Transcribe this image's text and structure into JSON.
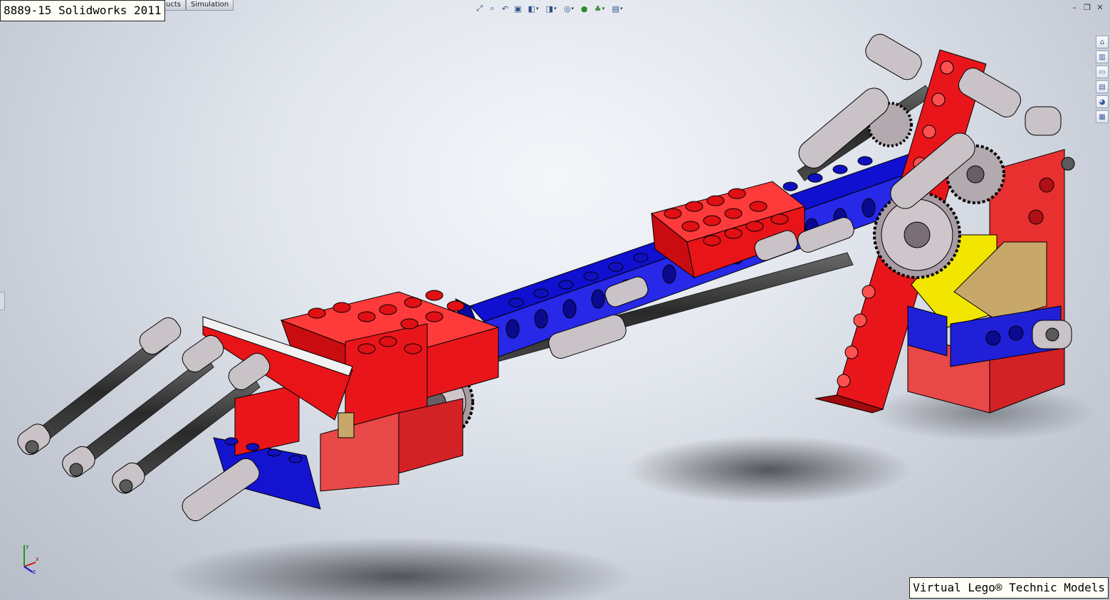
{
  "window": {
    "title": "8889-15 Solidworks 2011",
    "watermark": "Virtual Lego® Technic Models",
    "tabs": [
      "ucts",
      "Simulation"
    ]
  },
  "toolbar": {
    "icons": [
      {
        "name": "zoom-to-fit-icon",
        "glyph": "⤢"
      },
      {
        "name": "zoom-to-area-icon",
        "glyph": "⌕"
      },
      {
        "name": "previous-view-icon",
        "glyph": "↶"
      },
      {
        "name": "section-view-icon",
        "glyph": "▣"
      },
      {
        "name": "view-orientation-icon",
        "glyph": "◧",
        "dropdown": true
      },
      {
        "name": "display-style-icon",
        "glyph": "◨",
        "dropdown": true
      },
      {
        "name": "hide-show-items-icon",
        "glyph": "◎",
        "dropdown": true
      },
      {
        "name": "edit-appearance-icon",
        "glyph": "●",
        "dropdown": false
      },
      {
        "name": "apply-scene-icon",
        "glyph": "♣",
        "dropdown": true
      },
      {
        "name": "view-settings-icon",
        "glyph": "▤",
        "dropdown": true
      }
    ]
  },
  "window_controls": [
    {
      "name": "minimize-icon",
      "glyph": "–"
    },
    {
      "name": "restore-icon",
      "glyph": "❐"
    },
    {
      "name": "close-icon",
      "glyph": "✕"
    }
  ],
  "task_pane": [
    {
      "name": "solidworks-resources-icon",
      "glyph": "⌂"
    },
    {
      "name": "design-library-icon",
      "glyph": "▥"
    },
    {
      "name": "file-explorer-icon",
      "glyph": "▭"
    },
    {
      "name": "view-palette-icon",
      "glyph": "▤"
    },
    {
      "name": "appearances-scenes-icon",
      "glyph": "◕"
    },
    {
      "name": "custom-properties-icon",
      "glyph": "▦"
    }
  ],
  "triad": {
    "x": "x",
    "y": "y",
    "z": "z"
  },
  "colors": {
    "red": "#e8161b",
    "blue": "#1212c8",
    "yellow": "#f2e600",
    "tan": "#c8a86a",
    "gray": "#bdb6bb",
    "dark": "#3a3a3a"
  }
}
